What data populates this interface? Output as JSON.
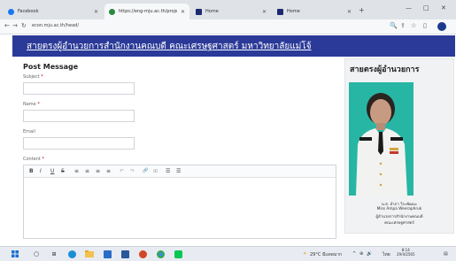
{
  "browser": {
    "tabs": [
      {
        "label": "Facebook",
        "favicon": "facebook-icon",
        "color": "#1877f2"
      },
      {
        "label": "https://eng-mju.ac.th/projects/...",
        "favicon": "globe-icon",
        "color": "#2b8a3e"
      },
      {
        "label": "Home",
        "favicon": "app-icon",
        "color": "#1e2a6e"
      },
      {
        "label": "Home",
        "favicon": "app-icon",
        "color": "#1e2a6e"
      }
    ],
    "address": "econ.mju.ac.th/head/"
  },
  "site": {
    "banner_title": "สายตรงผู้อำนวยการสำนักงานคณบดี คณะเศรษฐศาสตร์ มหาวิทยาลัยแม่โจ้",
    "banner_color": "#2b3a98"
  },
  "form": {
    "title": "Post Message",
    "subject_label": "Subject",
    "name_label": "Name",
    "email_label": "Email",
    "content_label": "Content",
    "required_mark": "*",
    "toolbar": [
      "B",
      "I",
      "U",
      "S",
      "≡",
      "≡",
      "≡",
      "≡",
      "↶",
      "↷",
      "🔗",
      "⊞",
      "☰",
      "☰"
    ]
  },
  "panel": {
    "title": "สายตรงผู้อำนวยการ",
    "caption_lines": [
      "น.ส. อำภา วีระพัฒนะ",
      "Miss Ampa Weeraphruk",
      "ผู้อำนวยการสำนักงานคณบดี",
      "คณะเศรษฐศาสตร์"
    ]
  },
  "taskbar": {
    "weather": "29°C มีแดดมาก",
    "tray_lang": "ไทย",
    "time": "8:14",
    "date": "29/4/2565"
  }
}
